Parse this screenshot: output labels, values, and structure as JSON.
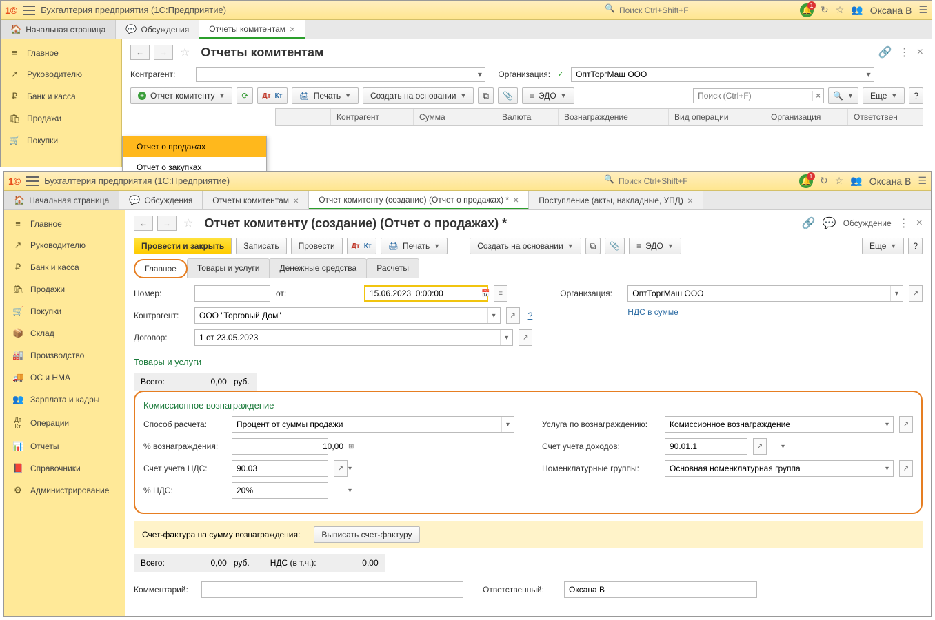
{
  "app": {
    "title": "Бухгалтерия предприятия  (1С:Предприятие)",
    "search_placeholder": "Поиск Ctrl+Shift+F",
    "notifications": "1",
    "user": "Оксана В"
  },
  "tabs_top": {
    "home": "Начальная страница",
    "discuss": "Обсуждения",
    "reports": "Отчеты комитентам"
  },
  "sidebar1": [
    {
      "icon": "≡",
      "label": "Главное"
    },
    {
      "icon": "↗",
      "label": "Руководителю"
    },
    {
      "icon": "₽",
      "label": "Банк и касса"
    },
    {
      "icon": "🛍",
      "label": "Продажи"
    },
    {
      "icon": "🛒",
      "label": "Покупки"
    }
  ],
  "page1": {
    "title": "Отчеты комитентам",
    "filter": {
      "counterparty_label": "Контрагент:",
      "org_label": "Организация:",
      "org_value": "ОптТоргМаш ООО"
    },
    "toolbar": {
      "create_label": "Отчет комитенту",
      "print_label": "Печать",
      "create_based": "Создать на основании",
      "edo": "ЭДО",
      "search_placeholder": "Поиск (Ctrl+F)",
      "more": "Еще"
    },
    "dropdown": {
      "item1": "Отчет о продажах",
      "item2": "Отчет о закупках"
    },
    "columns": [
      "",
      "Контрагент",
      "Сумма",
      "Валюта",
      "Вознаграждение",
      "Вид операции",
      "Организация",
      "Ответствен"
    ]
  },
  "tabs_bottom": {
    "home": "Начальная страница",
    "discuss": "Обсуждения",
    "reports": "Отчеты комитентам",
    "create": "Отчет комитенту (создание) (Отчет о продажах) *",
    "receipt": "Поступление (акты, накладные, УПД)"
  },
  "sidebar2": [
    {
      "icon": "≡",
      "label": "Главное"
    },
    {
      "icon": "↗",
      "label": "Руководителю"
    },
    {
      "icon": "₽",
      "label": "Банк и касса"
    },
    {
      "icon": "🛍",
      "label": "Продажи"
    },
    {
      "icon": "🛒",
      "label": "Покупки"
    },
    {
      "icon": "📦",
      "label": "Склад"
    },
    {
      "icon": "🏭",
      "label": "Производство"
    },
    {
      "icon": "🚚",
      "label": "ОС и НМА"
    },
    {
      "icon": "👥",
      "label": "Зарплата и кадры"
    },
    {
      "icon": "Дт",
      "label": "Операции"
    },
    {
      "icon": "📊",
      "label": "Отчеты"
    },
    {
      "icon": "📕",
      "label": "Справочники"
    },
    {
      "icon": "⚙",
      "label": "Администрирование"
    }
  ],
  "page2": {
    "title": "Отчет комитенту (создание) (Отчет о продажах) *",
    "discuss_btn": "Обсуждение",
    "toolbar": {
      "post_close": "Провести и закрыть",
      "save": "Записать",
      "post": "Провести",
      "print": "Печать",
      "create_based": "Создать на основании",
      "edo": "ЭДО",
      "more": "Еще"
    },
    "form_tabs": [
      "Главное",
      "Товары и услуги",
      "Денежные средства",
      "Расчеты"
    ],
    "fields": {
      "number_label": "Номер:",
      "from_label": "от:",
      "date_value": "15.06.2023  0:00:00",
      "org_label": "Организация:",
      "org_value": "ОптТоргМаш ООО",
      "counterparty_label": "Контрагент:",
      "counterparty_value": "ООО \"Торговый Дом\"",
      "nds_link": "НДС в сумме",
      "contract_label": "Договор:",
      "contract_value": "1 от 23.05.2023",
      "goods_section": "Товары и услуги",
      "total_label": "Всего:",
      "total_value": "0,00",
      "currency": "руб.",
      "commission_section": "Комиссионное вознаграждение",
      "calc_method_label": "Способ расчета:",
      "calc_method_value": "Процент от суммы продажи",
      "service_label": "Услуга по вознаграждению:",
      "service_value": "Комиссионное вознаграждение",
      "percent_label": "% вознаграждения:",
      "percent_value": "10,00",
      "income_acc_label": "Счет учета доходов:",
      "income_acc_value": "90.01.1",
      "nds_acc_label": "Счет учета НДС:",
      "nds_acc_value": "90.03",
      "nomen_label": "Номенклатурные группы:",
      "nomen_value": "Основная номенклатурная группа",
      "nds_percent_label": "% НДС:",
      "nds_percent_value": "20%",
      "invoice_label": "Счет-фактура на сумму вознаграждения:",
      "invoice_btn": "Выписать счет-фактуру",
      "total2_label": "Всего:",
      "total2_value": "0,00",
      "currency2": "руб.",
      "nds_incl_label": "НДС (в т.ч.):",
      "nds_incl_value": "0,00",
      "comment_label": "Комментарий:",
      "responsible_label": "Ответственный:",
      "responsible_value": "Оксана В"
    }
  }
}
